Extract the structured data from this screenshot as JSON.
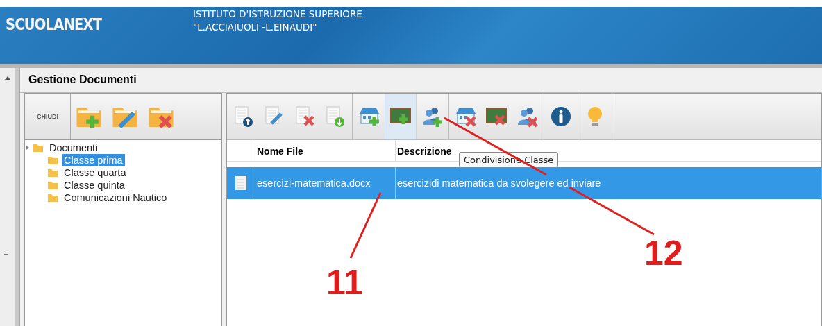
{
  "header": {
    "brand": "SCUOLANEXT",
    "school_lines": [
      "ISTITUTO D'ISTRUZIONE SUPERIORE",
      "\"L.ACCIAIUOLI -L.EINAUDI\""
    ]
  },
  "panel": {
    "title": "Gestione Documenti"
  },
  "left_toolbar": {
    "close_label": "CHIUDI",
    "buttons": [
      {
        "kind": "folder-add"
      },
      {
        "kind": "folder-edit"
      },
      {
        "kind": "folder-delete"
      }
    ]
  },
  "tree": {
    "label": "Documenti",
    "expanded": true,
    "children": [
      {
        "label": "Classe prima",
        "selected": true
      },
      {
        "label": "Classe quarta",
        "selected": false
      },
      {
        "label": "Classe quinta",
        "selected": false
      },
      {
        "label": "Comunicazioni Nautico",
        "selected": false
      }
    ]
  },
  "toolbar": {
    "groups": [
      [
        {
          "kind": "doc-upload",
          "hovered": false
        },
        {
          "kind": "doc-edit",
          "hovered": false
        },
        {
          "kind": "doc-delete",
          "hovered": false
        },
        {
          "kind": "doc-download",
          "hovered": false
        }
      ],
      [
        {
          "kind": "school-add",
          "hovered": false
        },
        {
          "kind": "board-add",
          "hovered": true
        },
        {
          "kind": "users-add",
          "hovered": false
        }
      ],
      [
        {
          "kind": "school-remove",
          "hovered": false
        },
        {
          "kind": "board-remove",
          "hovered": false
        },
        {
          "kind": "users-remove",
          "hovered": false
        }
      ],
      [
        {
          "kind": "info",
          "hovered": false
        }
      ],
      [
        {
          "kind": "bulb",
          "hovered": false
        }
      ]
    ]
  },
  "table": {
    "columns": [
      "Nome File",
      "Descrizione"
    ],
    "rows": [
      {
        "name": "esercizi-matematica.docx",
        "description": "esercizidi matematica da svolegere ed inviare",
        "selected": true
      }
    ]
  },
  "tooltip": {
    "text": "Condivisione Classe"
  },
  "annotations": [
    {
      "label": "11"
    },
    {
      "label": "12"
    }
  ]
}
